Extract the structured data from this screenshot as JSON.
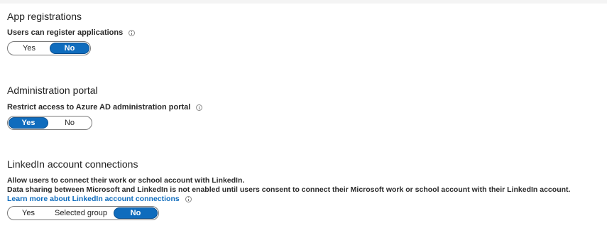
{
  "app_registrations": {
    "title": "App registrations",
    "setting_label": "Users can register applications",
    "toggle": {
      "options": [
        "Yes",
        "No"
      ],
      "selected": "No"
    }
  },
  "administration_portal": {
    "title": "Administration portal",
    "setting_label": "Restrict access to Azure AD administration portal",
    "toggle": {
      "options": [
        "Yes",
        "No"
      ],
      "selected": "Yes"
    }
  },
  "linkedin": {
    "title": "LinkedIn account connections",
    "description_line1": "Allow users to connect their work or school account with LinkedIn.",
    "description_line2": "Data sharing between Microsoft and LinkedIn is not enabled until users consent to connect their Microsoft work or school account with their LinkedIn account.",
    "learn_more_link": "Learn more about LinkedIn account connections",
    "toggle": {
      "options": [
        "Yes",
        "Selected group",
        "No"
      ],
      "selected": "No"
    }
  },
  "colors": {
    "accent": "#0f6cbd",
    "page_background": "#f4f4f4",
    "panel_background": "#ffffff"
  },
  "icons": [
    "info-icon"
  ]
}
